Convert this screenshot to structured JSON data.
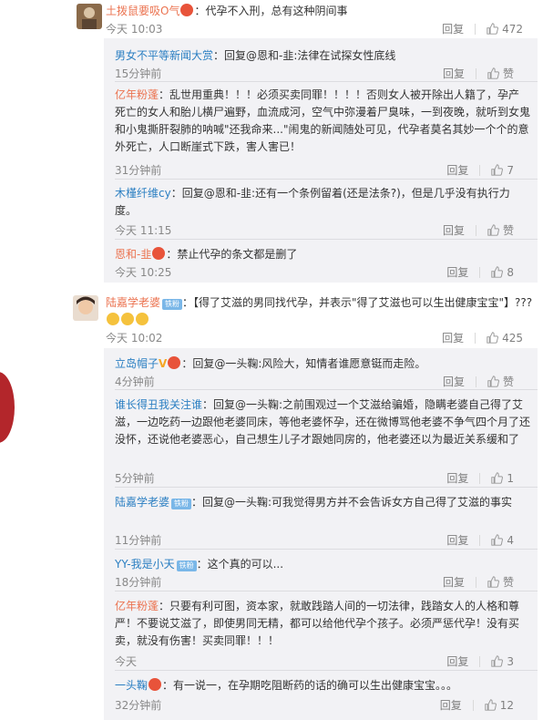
{
  "comments": [
    {
      "user": "土拨鼠要吸O气",
      "text": "：代孕不入刑，总有这种阴间事",
      "time": "今天 10:03",
      "reply_label": "回复",
      "likes": "472",
      "replies": [
        {
          "user": "男女不平等新闻大赏",
          "text": "：回复@恩和-韭:法律在试探女性底线",
          "time": "15分钟前",
          "reply_label": "回复",
          "likes": "赞"
        },
        {
          "user": "亿年粉蓬",
          "text": "：乱世用重典！！！必须买卖同罪！！！！否则女人被开除出人籍了，孕产死亡的女人和胎儿横尸遍野，血流成河，空气中弥漫着尸臭味，一到夜晚，就听到女鬼和小鬼撕肝裂肺的呐喊\"还我命来...\"闹鬼的新闻随处可见，代孕者莫名其妙一个个的意外死亡，人口断崖式下跌，害人害已！",
          "time": "31分钟前",
          "reply_label": "回复",
          "likes": "7"
        },
        {
          "user": "木槿纤维cy",
          "text": "：回复@恩和-韭:还有一个条例留着(还是法条?)，但是几乎没有执行力度。",
          "time": "今天 11:15",
          "reply_label": "回复",
          "likes": "赞"
        },
        {
          "user": "恩和-韭",
          "text": "：禁止代孕的条文都是删了",
          "time": "今天 10:25",
          "reply_label": "回复",
          "likes": "8"
        }
      ]
    },
    {
      "user": "陆嘉学老婆",
      "badge": "铁粉",
      "text": "：【得了艾滋的男同找代孕，并表示\"得了艾滋也可以生出健康宝宝\"】???",
      "time": "今天 10:02",
      "reply_label": "回复",
      "likes": "425",
      "replies": [
        {
          "user": "立岛帽子",
          "text": "：回复@一头鞠:风险大，知情者谁愿意铤而走险。",
          "time": "4分钟前",
          "reply_label": "回复",
          "likes": "赞"
        },
        {
          "user": "谁长得丑我关注谁",
          "text": "：回复@一头鞠:之前围观过一个艾滋给骗婚，隐瞒老婆自己得了艾滋，一边吃药一边跟他老婆同床，等他老婆怀孕，还在微博骂他老婆不争气四个月了还没怀，还说他老婆恶心，自己想生儿子才跟她同房的，他老婆还以为最近关系缓和了",
          "time": "5分钟前",
          "reply_label": "回复",
          "likes": "1"
        },
        {
          "user": "陆嘉学老婆",
          "badge": "铁粉",
          "text": "：回复@一头鞠:可我觉得男方并不会告诉女方自己得了艾滋的事实",
          "time": "11分钟前",
          "reply_label": "回复",
          "likes": "4"
        },
        {
          "user": "YY-我是小天",
          "badge": "铁粉",
          "text": "：这个真的可以...",
          "time": "18分钟前",
          "reply_label": "回复",
          "likes": "赞"
        },
        {
          "user": "亿年粉蓬",
          "text": "：只要有利可图，资本家，就敢践踏人间的一切法律，践踏女人的人格和尊严！不要说艾滋了，即使男同无精，都可以给他代孕个孩子。必须严惩代孕！没有买卖，就没有伤害！买卖同罪！！！",
          "time": "今天",
          "reply_label": "回复",
          "likes": "3"
        },
        {
          "user": "一头鞠",
          "text": "：有一说一，在孕期吃阻断药的话的确可以生出健康宝宝。。。",
          "time": "32分钟前",
          "reply_label": "回复",
          "likes": "12"
        }
      ]
    }
  ]
}
